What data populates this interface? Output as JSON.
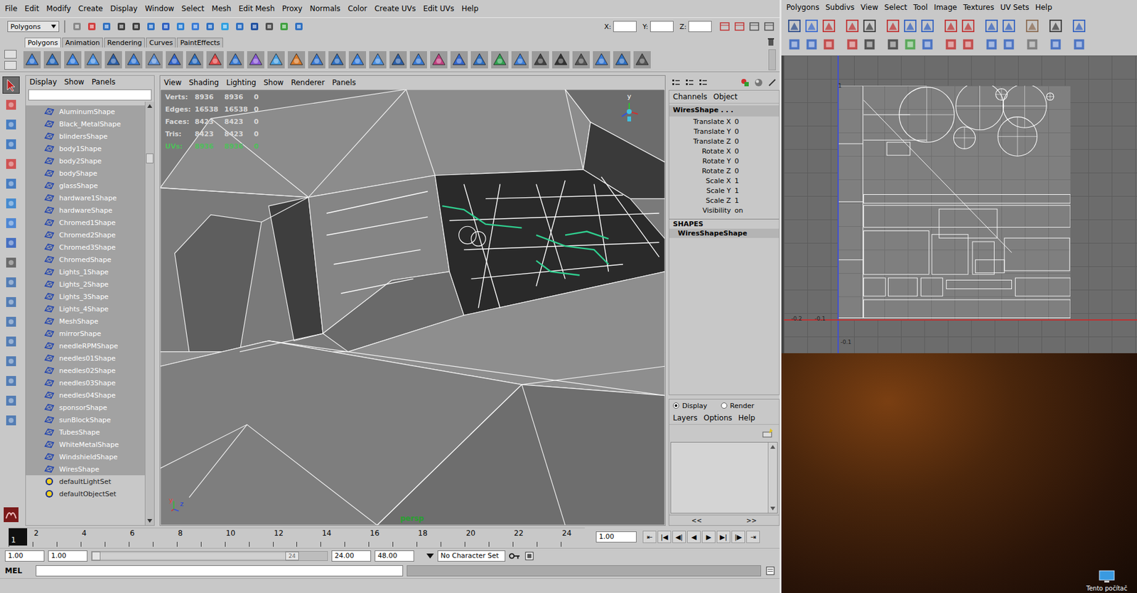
{
  "maya": {
    "menus": [
      "File",
      "Edit",
      "Modify",
      "Create",
      "Display",
      "Window",
      "Select",
      "Mesh",
      "Edit Mesh",
      "Proxy",
      "Normals",
      "Color",
      "Create UVs",
      "Edit UVs",
      "Help"
    ],
    "status_line": {
      "mode": "Polygons",
      "fields": [
        {
          "label": "X:",
          "value": ""
        },
        {
          "label": "Y:",
          "value": ""
        },
        {
          "label": "Z:",
          "value": ""
        }
      ]
    },
    "shelf_tabs": [
      {
        "label": "Polygons",
        "selected": true
      },
      {
        "label": "Animation",
        "selected": false
      },
      {
        "label": "Rendering",
        "selected": false
      },
      {
        "label": "Curves",
        "selected": false
      },
      {
        "label": "PaintEffects",
        "selected": false
      }
    ],
    "outliner": {
      "menus": [
        "Display",
        "Show",
        "Panels"
      ],
      "search": "",
      "items": [
        {
          "label": "AluminumShape",
          "kind": "mesh",
          "selected": true
        },
        {
          "label": "Black_MetalShape",
          "kind": "mesh",
          "selected": true
        },
        {
          "label": "blindersShape",
          "kind": "mesh",
          "selected": true
        },
        {
          "label": "body1Shape",
          "kind": "mesh",
          "selected": true
        },
        {
          "label": "body2Shape",
          "kind": "mesh",
          "selected": true
        },
        {
          "label": "bodyShape",
          "kind": "mesh",
          "selected": true
        },
        {
          "label": "glassShape",
          "kind": "mesh",
          "selected": true
        },
        {
          "label": "hardware1Shape",
          "kind": "mesh",
          "selected": true
        },
        {
          "label": "hardwareShape",
          "kind": "mesh",
          "selected": true
        },
        {
          "label": "Chromed1Shape",
          "kind": "mesh",
          "selected": true
        },
        {
          "label": "Chromed2Shape",
          "kind": "mesh",
          "selected": true
        },
        {
          "label": "Chromed3Shape",
          "kind": "mesh",
          "selected": true
        },
        {
          "label": "ChromedShape",
          "kind": "mesh",
          "selected": true
        },
        {
          "label": "Lights_1Shape",
          "kind": "mesh",
          "selected": true
        },
        {
          "label": "Lights_2Shape",
          "kind": "mesh",
          "selected": true
        },
        {
          "label": "Lights_3Shape",
          "kind": "mesh",
          "selected": true
        },
        {
          "label": "Lights_4Shape",
          "kind": "mesh",
          "selected": true
        },
        {
          "label": "MeshShape",
          "kind": "mesh",
          "selected": true
        },
        {
          "label": "mirrorShape",
          "kind": "mesh",
          "selected": true
        },
        {
          "label": "needleRPMShape",
          "kind": "mesh",
          "selected": true
        },
        {
          "label": "needles01Shape",
          "kind": "mesh",
          "selected": true
        },
        {
          "label": "needles02Shape",
          "kind": "mesh",
          "selected": true
        },
        {
          "label": "needles03Shape",
          "kind": "mesh",
          "selected": true
        },
        {
          "label": "needles04Shape",
          "kind": "mesh",
          "selected": true
        },
        {
          "label": "sponsorShape",
          "kind": "mesh",
          "selected": true
        },
        {
          "label": "sunBlockShape",
          "kind": "mesh",
          "selected": true
        },
        {
          "label": "TubesShape",
          "kind": "mesh",
          "selected": true
        },
        {
          "label": "WhiteMetalShape",
          "kind": "mesh",
          "selected": true
        },
        {
          "label": "WindshieldShape",
          "kind": "mesh",
          "selected": true
        },
        {
          "label": "WiresShape",
          "kind": "mesh",
          "selected": true
        },
        {
          "label": "defaultLightSet",
          "kind": "set",
          "selected": false
        },
        {
          "label": "defaultObjectSet",
          "kind": "set",
          "selected": false
        }
      ]
    },
    "viewport": {
      "menus": [
        "View",
        "Shading",
        "Lighting",
        "Show",
        "Renderer",
        "Panels"
      ],
      "hud": [
        {
          "label": "Verts:",
          "values": [
            "8936",
            "8936",
            "0"
          ],
          "color": "#d8d8d8"
        },
        {
          "label": "Edges:",
          "values": [
            "16538",
            "16538",
            "0"
          ],
          "color": "#d8d8d8"
        },
        {
          "label": "Faces:",
          "values": [
            "8423",
            "8423",
            "0"
          ],
          "color": "#d8d8d8"
        },
        {
          "label": "Tris:",
          "values": [
            "8423",
            "8423",
            "0"
          ],
          "color": "#d8d8d8"
        },
        {
          "label": "UVs:",
          "values": [
            "8936",
            "8936",
            "0"
          ],
          "color": "#4fbf5a"
        }
      ],
      "camera": "persp",
      "axis_top": "y",
      "axis_bottom": [
        "y",
        "z"
      ]
    },
    "channel_box": {
      "menus": [
        "Channels",
        "Object"
      ],
      "object": "WiresShape . . .",
      "attributes": [
        {
          "label": "Translate X",
          "value": "0"
        },
        {
          "label": "Translate Y",
          "value": "0"
        },
        {
          "label": "Translate Z",
          "value": "0"
        },
        {
          "label": "Rotate X",
          "value": "0"
        },
        {
          "label": "Rotate Y",
          "value": "0"
        },
        {
          "label": "Rotate Z",
          "value": "0"
        },
        {
          "label": "Scale X",
          "value": "1"
        },
        {
          "label": "Scale Y",
          "value": "1"
        },
        {
          "label": "Scale Z",
          "value": "1"
        },
        {
          "label": "Visibility",
          "value": "on"
        }
      ],
      "shapes_header": "SHAPES",
      "shape": "WiresShapeShape"
    },
    "layer_editor": {
      "modes": [
        {
          "label": "Display",
          "selected": true
        },
        {
          "label": "Render",
          "selected": false
        }
      ],
      "menus": [
        "Layers",
        "Options",
        "Help"
      ],
      "nav": [
        "<<",
        ">>"
      ]
    },
    "time_slider": {
      "ticks": [
        {
          "label": "2"
        },
        {
          "label": "4"
        },
        {
          "label": "6"
        },
        {
          "label": "8"
        },
        {
          "label": "10"
        },
        {
          "label": "12"
        },
        {
          "label": "14"
        },
        {
          "label": "16"
        },
        {
          "label": "18"
        },
        {
          "label": "20"
        },
        {
          "label": "22"
        },
        {
          "label": "24"
        }
      ],
      "current": "1",
      "current_time": "1.00",
      "controls": [
        "⇤",
        "|◀",
        "◀|",
        "◀",
        "▶",
        "▶|",
        "|▶",
        "⇥"
      ]
    },
    "range_slider": {
      "start": "1.00",
      "range_start": "1.00",
      "handle_end": "24",
      "range_end": "24.00",
      "end": "48.00",
      "character_set": "No Character Set"
    },
    "command_line": {
      "language": "MEL",
      "input": ""
    }
  },
  "uv_editor": {
    "menus": [
      "Polygons",
      "Subdivs",
      "View",
      "Select",
      "Tool",
      "Image",
      "Textures",
      "UV Sets",
      "Help"
    ],
    "labels": [
      {
        "text": "1"
      },
      {
        "text": "-0.2"
      },
      {
        "text": "-0.1"
      },
      {
        "text": "-0.1"
      }
    ]
  },
  "desktop": {
    "icon_label": "Tento počítač"
  }
}
